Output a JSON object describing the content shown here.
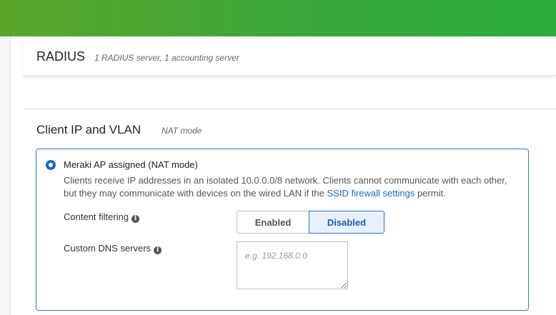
{
  "header": {
    "accent_color": "#3aa83a"
  },
  "radius": {
    "title": "RADIUS",
    "subtitle": "1 RADIUS server, 1 accounting server"
  },
  "client_ip": {
    "title": "Client IP and VLAN",
    "mode": "NAT mode",
    "option": {
      "label": "Meraki AP assigned (NAT mode)",
      "selected": true,
      "description_before_link": "Clients receive IP addresses in an isolated 10.0.0.0/8 network. Clients cannot communicate with each other, but they may communicate with devices on the wired LAN if the ",
      "link_text": "SSID firewall settings",
      "description_after_link": " permit."
    },
    "content_filtering": {
      "label": "Content filtering",
      "icon": "info-icon",
      "options": [
        "Enabled",
        "Disabled"
      ],
      "selected": "Disabled"
    },
    "custom_dns": {
      "label": "Custom DNS servers",
      "icon": "info-icon",
      "placeholder": "e.g. 192.168.0.0",
      "value": ""
    }
  }
}
